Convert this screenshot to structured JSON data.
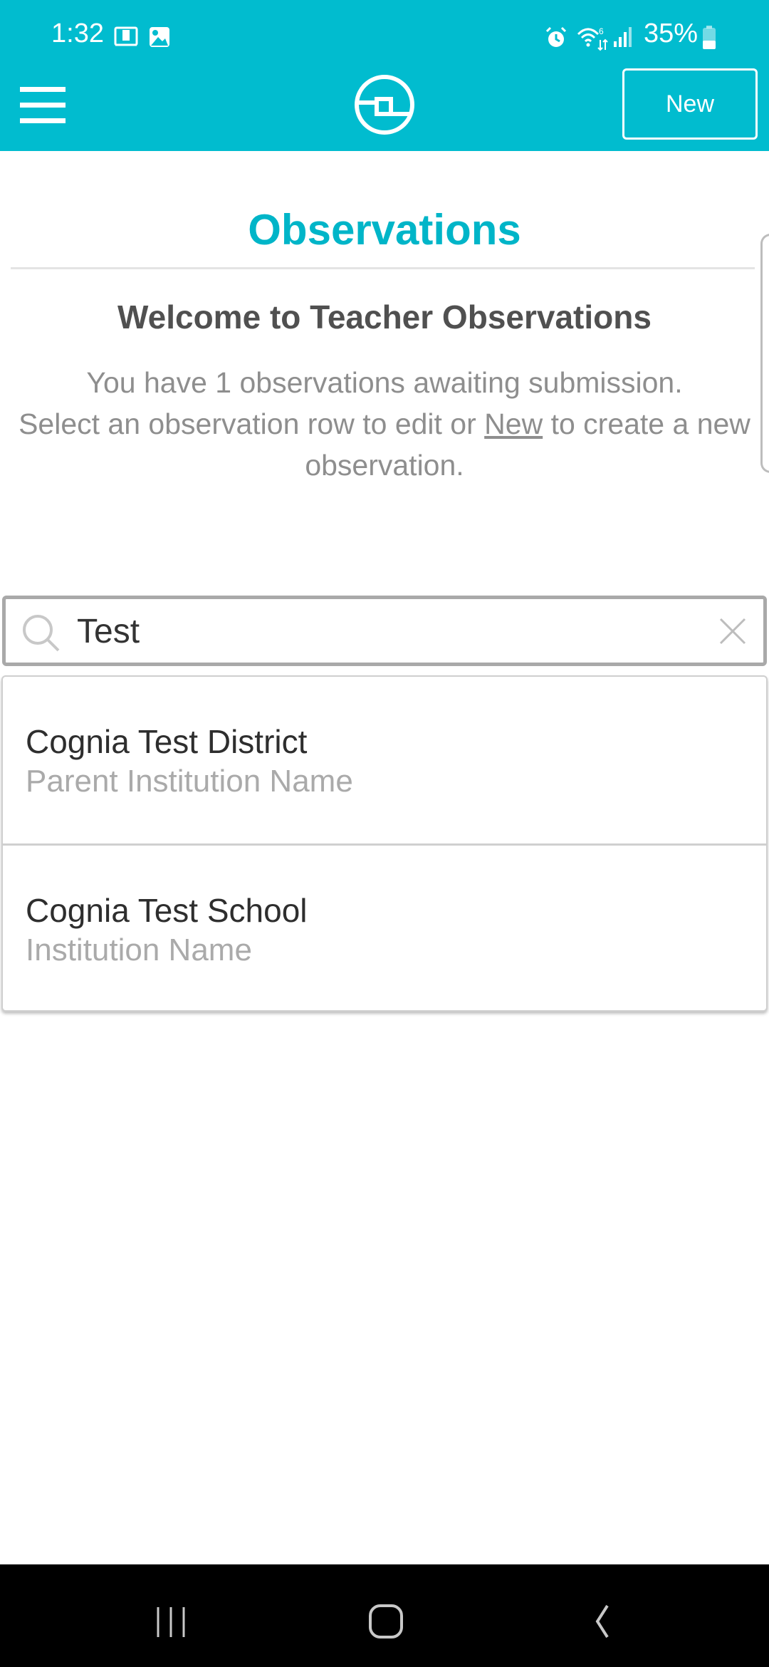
{
  "status_bar": {
    "time": "1:32",
    "left_icons": [
      "amazon-kindle-icon",
      "gallery-icon"
    ],
    "right_icons": [
      "alarm-icon",
      "wifi-6-icon",
      "signal-icon",
      "battery-icon"
    ],
    "battery_percent": "35%"
  },
  "header": {
    "menu_icon": "hamburger-menu-icon",
    "logo_icon": "cognia-logo-icon",
    "new_button_label": "New",
    "background_color": "#01bccf"
  },
  "page": {
    "title": "Observations",
    "welcome_heading": "Welcome to Teacher Observations",
    "intro_line1": "You have 1 observations awaiting submission.",
    "intro_line2_before": "Select an observation row to edit or ",
    "intro_link": "New",
    "intro_line2_after": " to create a new observation.",
    "accent_color": "#00b5c8"
  },
  "search": {
    "value": "Test",
    "search_icon": "search-icon",
    "clear_icon": "close-icon"
  },
  "results": [
    {
      "name": "Cognia Test District",
      "type": "Parent Institution Name"
    },
    {
      "name": "Cognia Test School",
      "type": "Institution Name"
    }
  ],
  "nav_bar": {
    "buttons": [
      "recent-apps-icon",
      "home-icon",
      "back-icon"
    ]
  }
}
